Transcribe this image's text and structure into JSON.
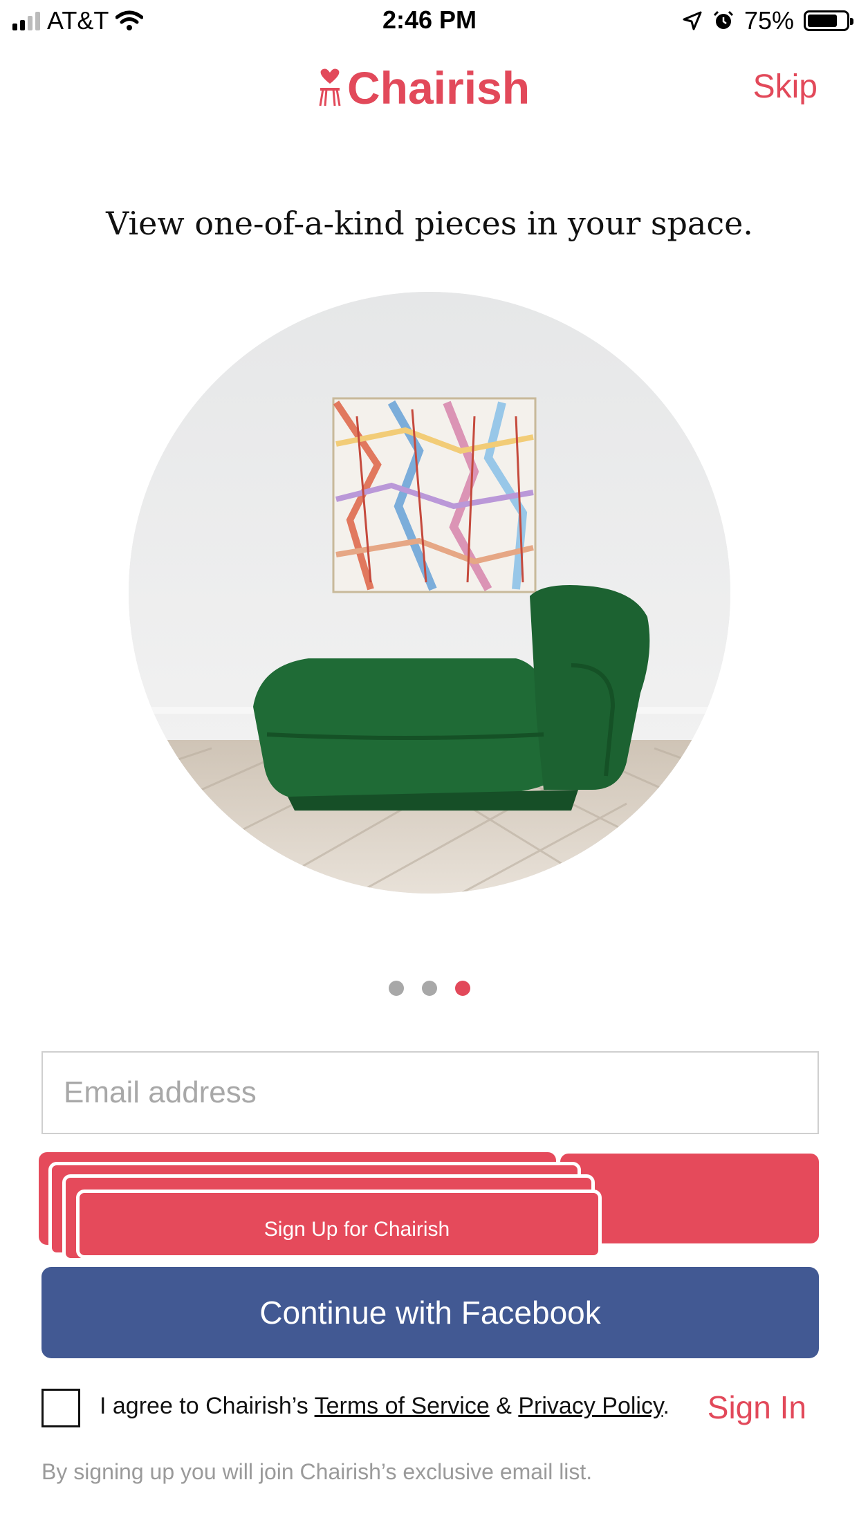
{
  "status_bar": {
    "carrier": "AT&T",
    "time": "2:46 PM",
    "battery": "75%"
  },
  "header": {
    "logo_text": "Chairish",
    "skip_label": "Skip"
  },
  "onboarding": {
    "tagline": "View one-of-a-kind pieces in your space.",
    "pager": {
      "total": 3,
      "active_index": 2
    }
  },
  "form": {
    "email_placeholder": "Email address",
    "email_value": "",
    "signup_label": "Sign Up for Chairish",
    "facebook_label": "Continue with Facebook",
    "agree_prefix": "I agree to Chairish’s ",
    "terms_link": "Terms of Service",
    "agree_and": " & ",
    "privacy_link": "Privacy Policy",
    "agree_suffix": ".",
    "signin_label": "Sign In",
    "footnote": "By signing up you will join Chairish’s exclusive email list."
  },
  "colors": {
    "brand": "#e2495a",
    "facebook": "#425993"
  }
}
